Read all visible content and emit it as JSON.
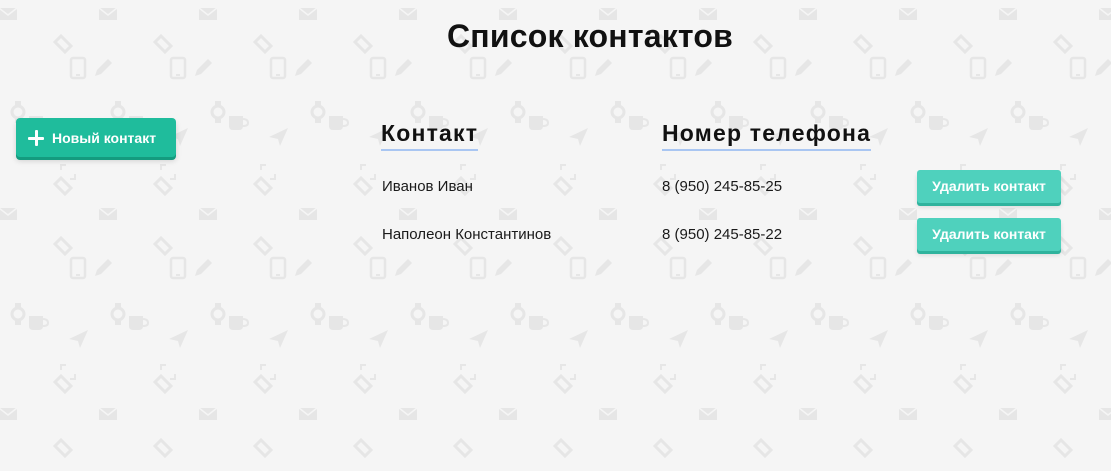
{
  "page": {
    "title": "Список контактов"
  },
  "toolbar": {
    "new_contact_label": "Новый контакт"
  },
  "table": {
    "columns": [
      "Контакт",
      "Номер телефона"
    ],
    "rows": [
      {
        "name": "Иванов Иван",
        "phone": "8 (950) 245-85-25",
        "delete_label": "Удалить контакт"
      },
      {
        "name": "Наполеон Константинов",
        "phone": "8 (950) 245-85-22",
        "delete_label": "Удалить контакт"
      }
    ]
  },
  "colors": {
    "accent": "#1fbc9c",
    "delete_button": "#4fd1bd",
    "header_underline": "#a9c6f2",
    "background": "#f5f5f5"
  },
  "icons": {
    "new_contact_icon": "plus-icon",
    "background_pattern": [
      "envelope-icon",
      "phone-icon",
      "pencil-icon",
      "cup-icon",
      "paper-plane-icon",
      "expand-icon",
      "tag-icon",
      "watch-icon"
    ]
  }
}
